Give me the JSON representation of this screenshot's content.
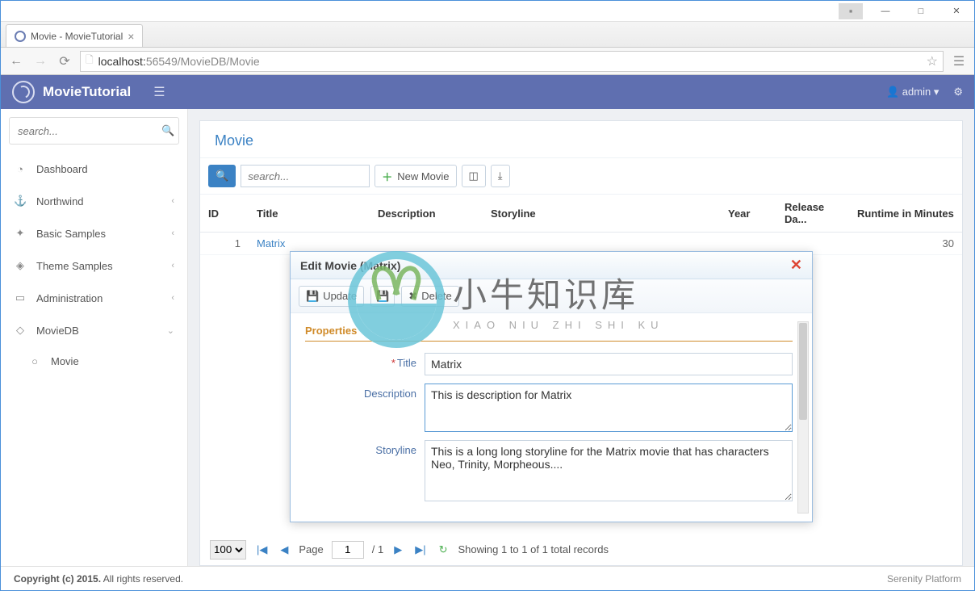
{
  "window": {
    "tab_title": "Movie - MovieTutorial",
    "url_host": "localhost:",
    "url_port": "56549",
    "url_path": "/MovieDB/Movie"
  },
  "appbar": {
    "brand": "MovieTutorial",
    "user": "admin"
  },
  "sidebar": {
    "search_placeholder": "search...",
    "items": [
      {
        "label": "Dashboard",
        "icon": "◔",
        "expandable": false
      },
      {
        "label": "Northwind",
        "icon": "⚓",
        "expandable": true
      },
      {
        "label": "Basic Samples",
        "icon": "✦",
        "expandable": true
      },
      {
        "label": "Theme Samples",
        "icon": "◈",
        "expandable": true
      },
      {
        "label": "Administration",
        "icon": "▭",
        "expandable": true
      },
      {
        "label": "MovieDB",
        "icon": "◇",
        "expandable": true,
        "expanded": true
      },
      {
        "label": "Movie",
        "icon": "○",
        "expandable": false,
        "sub": true
      }
    ]
  },
  "page": {
    "title": "Movie",
    "search_placeholder": "search...",
    "new_button": "New Movie",
    "columns": [
      "ID",
      "Title",
      "Description",
      "Storyline",
      "Year",
      "Release Da...",
      "Runtime in Minutes"
    ],
    "rows": [
      {
        "id": "1",
        "title": "Matrix",
        "description": "",
        "storyline": "",
        "year": "",
        "release": "",
        "runtime": "30"
      }
    ]
  },
  "pager": {
    "page_size": "100",
    "page_label": "Page",
    "page": "1",
    "total_pages": "/ 1",
    "summary": "Showing 1 to 1 of 1 total records"
  },
  "dialog": {
    "title": "Edit Movie (Matrix)",
    "update": "Update",
    "save": "",
    "delete": "Delete",
    "section": "Properties",
    "fields": {
      "title_label": "Title",
      "title_value": "Matrix",
      "description_label": "Description",
      "description_value": "This is description for Matrix",
      "storyline_label": "Storyline",
      "storyline_value": "This is a long long storyline for the Matrix movie that has characters Neo, Trinity, Morpheous...."
    }
  },
  "footer": {
    "copyright_bold": "Copyright (c) 2015.",
    "copyright_rest": " All rights reserved.",
    "platform": "Serenity Platform"
  },
  "watermark": {
    "cn": "小牛知识库",
    "en": "XIAO NIU ZHI SHI KU"
  }
}
